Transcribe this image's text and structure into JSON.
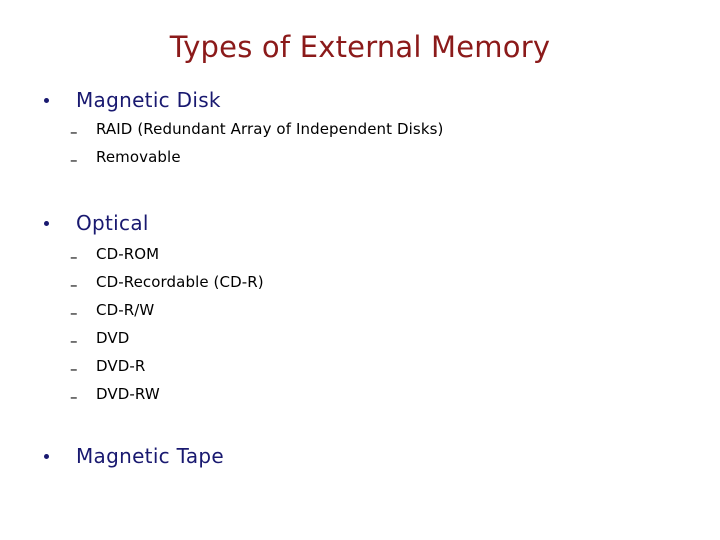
{
  "slide": {
    "title": "Types of External Memory",
    "background_color": "#ffffff",
    "title_color": "#8B1A1A",
    "level1_color": "#191970",
    "level2_color": "#000000",
    "level1_marker": "•",
    "level2_marker": "–"
  },
  "content": {
    "sections": [
      {
        "heading": "Magnetic Disk",
        "items": [
          "RAID (Redundant Array of Independent Disks)",
          "Removable"
        ]
      },
      {
        "heading": "Optical",
        "items": [
          "CD-ROM",
          "CD-Recordable (CD-R)",
          "CD-R/W",
          "DVD",
          "DVD-R",
          "DVD-RW"
        ]
      },
      {
        "heading": "Magnetic Tape",
        "items": []
      }
    ]
  }
}
